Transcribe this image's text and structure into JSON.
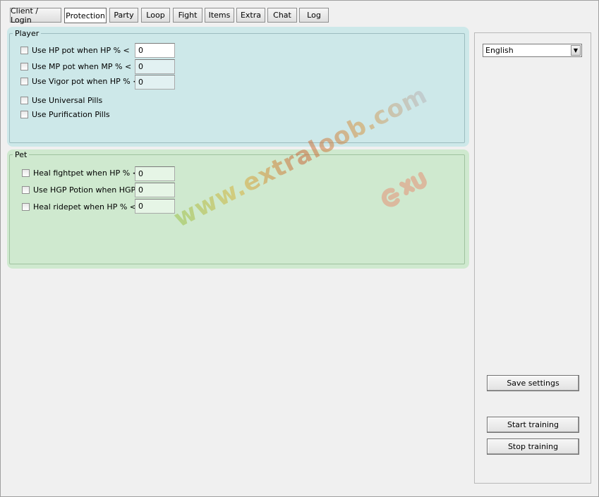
{
  "tabs": [
    "Client / Login",
    "Protection",
    "Party",
    "Loop",
    "Fight",
    "Items",
    "Extra",
    "Chat",
    "Log"
  ],
  "active_tab": "Protection",
  "player": {
    "title": "Player",
    "rows": [
      {
        "label": "Use HP pot when HP % <",
        "value": "0"
      },
      {
        "label": "Use MP pot when MP % <",
        "value": "0"
      },
      {
        "label": "Use Vigor pot when HP % <",
        "value": "0"
      },
      {
        "label": "Use Universal Pills"
      },
      {
        "label": "Use Purification Pills"
      }
    ]
  },
  "pet": {
    "title": "Pet",
    "rows": [
      {
        "label": "Heal fightpet when HP % <",
        "value": "0"
      },
      {
        "label": "Use HGP Potion when HGP %",
        "value": "0"
      },
      {
        "label": "Heal ridepet when HP % <",
        "value": "0"
      }
    ]
  },
  "language": {
    "selected": "English"
  },
  "buttons": {
    "save": "Save settings",
    "start": "Start training",
    "stop": "Stop training"
  },
  "watermark": {
    "text": "www.extraloob.com"
  },
  "colors": {
    "player_bg": "#cde8e9",
    "pet_bg": "#cfe9cf"
  }
}
